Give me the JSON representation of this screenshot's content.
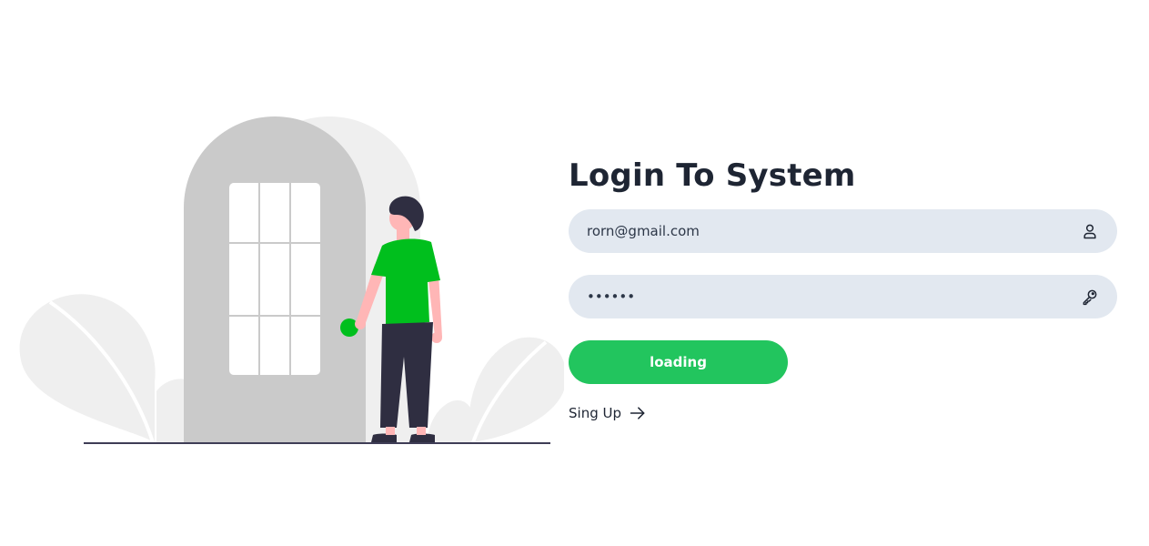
{
  "login": {
    "title": "Login To System",
    "email": {
      "value": "rorn@gmail.com",
      "icon": "user-icon"
    },
    "password": {
      "value": "••••••",
      "icon": "key-icon"
    },
    "submit_label": "loading",
    "signup_label": "Sing Up",
    "signup_icon": "arrow-right-icon"
  },
  "colors": {
    "accent": "#22c55e",
    "person_shirt": "#00bf1d",
    "input_bg": "#e2e8f0",
    "title": "#1e2533"
  }
}
